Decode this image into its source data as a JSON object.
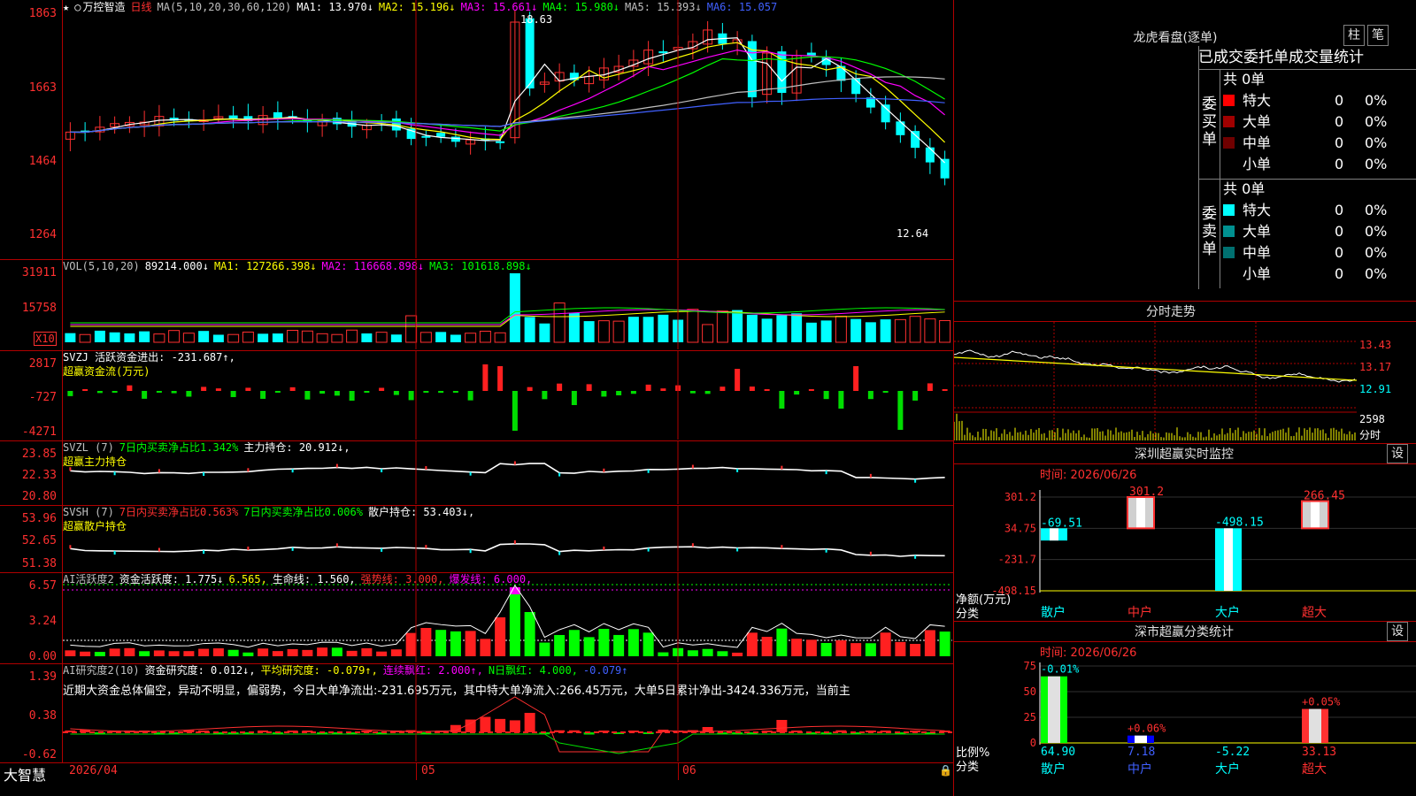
{
  "stock": {
    "name": "万控智造",
    "period": "日线"
  },
  "main_panel": {
    "ma_label": "MA(5,10,20,30,60,120)",
    "ma": [
      {
        "label": "MA1: 13.970↓",
        "color": "#ffffff"
      },
      {
        "label": "MA2: 15.196↓",
        "color": "#ffff00"
      },
      {
        "label": "MA3: 15.661↓",
        "color": "#ff00ff"
      },
      {
        "label": "MA4: 15.980↓",
        "color": "#00ff00"
      },
      {
        "label": "MA5: 15.393↓",
        "color": "#c0c0c0"
      },
      {
        "label": "MA6: 15.057",
        "color": "#4060ff"
      }
    ],
    "ticks": [
      "1863",
      "1663",
      "1464",
      "1264"
    ],
    "high_mark": "18.63",
    "low_mark": "12.64"
  },
  "vol_panel": {
    "label": "VOL(5,10,20)",
    "values": [
      {
        "label": "89214.000↓",
        "color": "#ffffff"
      },
      {
        "label": "MA1: 127266.398↓",
        "color": "#ffff00"
      },
      {
        "label": "MA2: 116668.898↓",
        "color": "#ff00ff"
      },
      {
        "label": "MA3: 101618.898↓",
        "color": "#00ff00"
      }
    ],
    "ticks": [
      "31911",
      "15758"
    ],
    "unit": "X10"
  },
  "svzj_panel": {
    "line1": "SVZJ  活跃资金进出: -231.687↑,",
    "line2": "超赢资金流(万元)",
    "ticks": [
      "2817",
      "-727",
      "-4271"
    ]
  },
  "svzl_panel": {
    "name": "SVZL (7)",
    "v1": "7日内买卖净占比1.342%",
    "v2": "主力持仓: 20.912↓,",
    "line2": "超赢主力持仓",
    "ticks": [
      "23.85",
      "22.33",
      "20.80"
    ]
  },
  "svsh_panel": {
    "name": "SVSH (7)",
    "v1": "7日内买卖净占比0.563%",
    "v2": "7日内买卖净占比0.006%",
    "v3": "散户持仓: 53.403↓,",
    "line2": "超赢散户持仓",
    "ticks": [
      "53.96",
      "52.65",
      "51.38"
    ]
  },
  "ai_active_panel": {
    "name": "AI活跃度2",
    "v1": "资金活跃度: 1.775↓",
    "v2": "6.565,",
    "v3": "生命线: 1.560,",
    "v4": "强势线: 3.000,",
    "v5": "爆发线: 6.000,",
    "ticks": [
      "6.57",
      "3.24",
      "0.00"
    ]
  },
  "ai_research_panel": {
    "name": "AI研究度2(10)",
    "v1": "资金研究度: 0.012↓,",
    "v2": "平均研究度: -0.079↑,",
    "v3": "连续飘红: 2.000↑,",
    "v4": "N日飘红: 4.000,",
    "v5": "-0.079↑",
    "text": "近期大资金总体偏空，异动不明显，偏弱势，今日大单净流出:-231.695万元，其中特大单净流入:266.45万元，大单5日累计净出-3424.336万元，当前主",
    "ticks": [
      "1.39",
      "0.38",
      "-0.62"
    ]
  },
  "xaxis": {
    "brand": "大智慧",
    "labels": [
      "2026/04",
      "05",
      "06"
    ]
  },
  "lhb": {
    "title": "龙虎看盘(逐单)",
    "btn1": "柱",
    "btn2": "笔",
    "tabs": "已成交委托单成交量统计",
    "buy_label": "委买单",
    "sell_label": "委卖单",
    "buy_total": "共 0单",
    "sell_total": "共 0单",
    "buy_rows": [
      {
        "name": "特大",
        "count": "0",
        "pct": "0%",
        "color": "#ff0000"
      },
      {
        "name": "大单",
        "count": "0",
        "pct": "0%",
        "color": "#a00000"
      },
      {
        "name": "中单",
        "count": "0",
        "pct": "0%",
        "color": "#700000"
      },
      {
        "name": "小单",
        "count": "0",
        "pct": "0%",
        "color": ""
      }
    ],
    "sell_rows": [
      {
        "name": "特大",
        "count": "0",
        "pct": "0%",
        "color": "#00ffff"
      },
      {
        "name": "大单",
        "count": "0",
        "pct": "0%",
        "color": "#009090"
      },
      {
        "name": "中单",
        "count": "0",
        "pct": "0%",
        "color": "#007070"
      },
      {
        "name": "小单",
        "count": "0",
        "pct": "0%",
        "color": ""
      }
    ]
  },
  "intraday": {
    "title": "分时走势",
    "ticks": [
      "13.43",
      "13.17",
      "12.91"
    ],
    "vol_tick": "2598",
    "label": "分时"
  },
  "sz_monitor": {
    "title": "深圳超赢实时监控",
    "btn": "设",
    "time": "时间: 2026/06/26",
    "ticks": [
      "301.2",
      "34.75",
      "-231.7",
      "-498.15"
    ],
    "unit": "净额(万元)",
    "cat_label": "分类",
    "chart_data": {
      "type": "bar",
      "categories": [
        "散户",
        "中户",
        "大户",
        "超大"
      ],
      "values": [
        -69.51,
        301.2,
        -498.15,
        266.45
      ],
      "labels": [
        "-69.51",
        "301.2",
        "-498.15",
        "266.45"
      ],
      "ylim": [
        -498.15,
        301.2
      ]
    }
  },
  "sz_class": {
    "title": "深市超赢分类统计",
    "btn": "设",
    "time": "时间: 2026/06/26",
    "ticks": [
      "75",
      "50",
      "25",
      "0"
    ],
    "unit": "比例%",
    "cat_label": "分类",
    "chart_data": {
      "type": "bar",
      "categories": [
        "散户",
        "中户",
        "大户",
        "超大"
      ],
      "values": [
        64.9,
        7.18,
        -5.22,
        33.13
      ],
      "changes": [
        "-0.01%",
        "+0.06%",
        "",
        "+0.05%"
      ],
      "value_labels": [
        "64.90",
        "7.18",
        "-5.22",
        "33.13"
      ],
      "ylim": [
        0,
        75
      ]
    }
  }
}
